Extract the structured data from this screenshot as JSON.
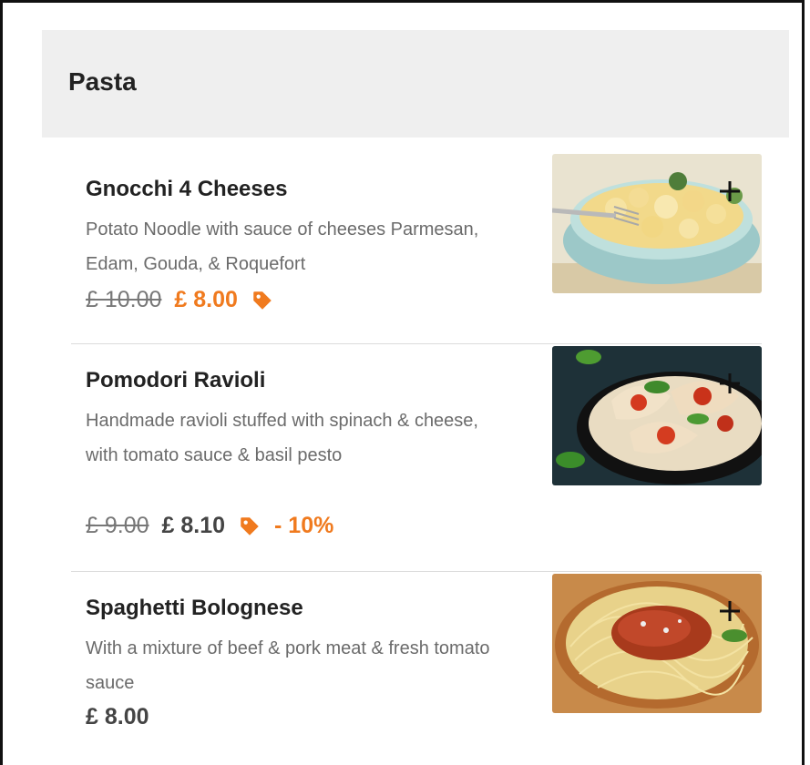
{
  "category": {
    "title": "Pasta"
  },
  "items": [
    {
      "name": "Gnocchi 4 Cheeses",
      "description": "Potato Noodle with sauce of cheeses Parmesan, Edam, Gouda, & Roquefort",
      "old_price": "£ 10.00",
      "price": "£ 8.00",
      "discount": "",
      "icon": "tag-icon",
      "add_icon": "plus-icon"
    },
    {
      "name": "Pomodori Ravioli",
      "description": "Handmade ravioli stuffed with spinach & cheese, with tomato sauce & basil pesto",
      "old_price": "£ 9.00",
      "price": "£ 8.10",
      "discount": "- 10%",
      "icon": "tag-icon",
      "add_icon": "plus-icon"
    },
    {
      "name": "Spaghetti Bolognese",
      "description": "With a mixture of beef & pork meat & fresh tomato sauce",
      "price": "£ 8.00",
      "add_icon": "plus-icon"
    }
  ],
  "colors": {
    "accent": "#f07a1e",
    "header_bg": "#efefef",
    "text": "#222222",
    "muted": "#6b6b6b"
  }
}
